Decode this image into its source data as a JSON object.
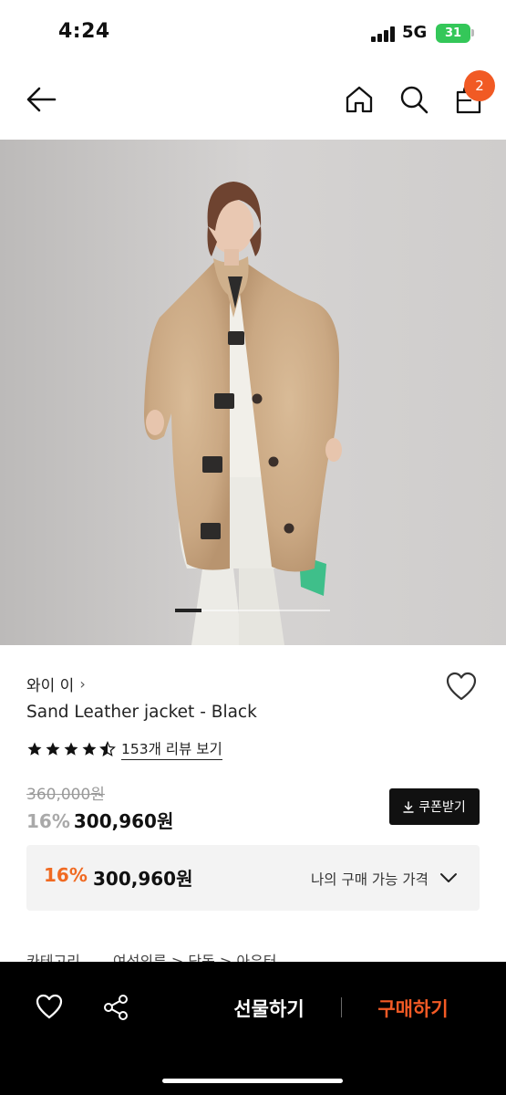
{
  "status_bar": {
    "time": "4:24",
    "network": "5G",
    "battery": "31"
  },
  "nav": {
    "cart_count": "2",
    "icons": [
      "back-arrow-icon",
      "home-icon",
      "search-icon",
      "cart-icon"
    ]
  },
  "hero": {
    "slide_current": 1
  },
  "product": {
    "brand": "와이 이",
    "name": "Sand Leather jacket - Black",
    "rating": 4.5,
    "review_link": "153개 리뷰 보기",
    "original_price": "360,000원",
    "discount_rate": "16%",
    "discount_price": "300,960원",
    "coupon_button": "쿠폰받기"
  },
  "my_price": {
    "rate": "16%",
    "price": "300,960원",
    "label": "나의 구매 가능 가격"
  },
  "category": {
    "label": "카테고리",
    "path": "여성의류 > 단독 > 아우터"
  },
  "bottom_bar": {
    "gift_label": "선물하기",
    "buy_label": "구매하기"
  },
  "colors": {
    "accent": "#f15a24",
    "buy_text": "#f35a25",
    "discount_orange": "#f06a22",
    "battery_green": "#34c759"
  }
}
